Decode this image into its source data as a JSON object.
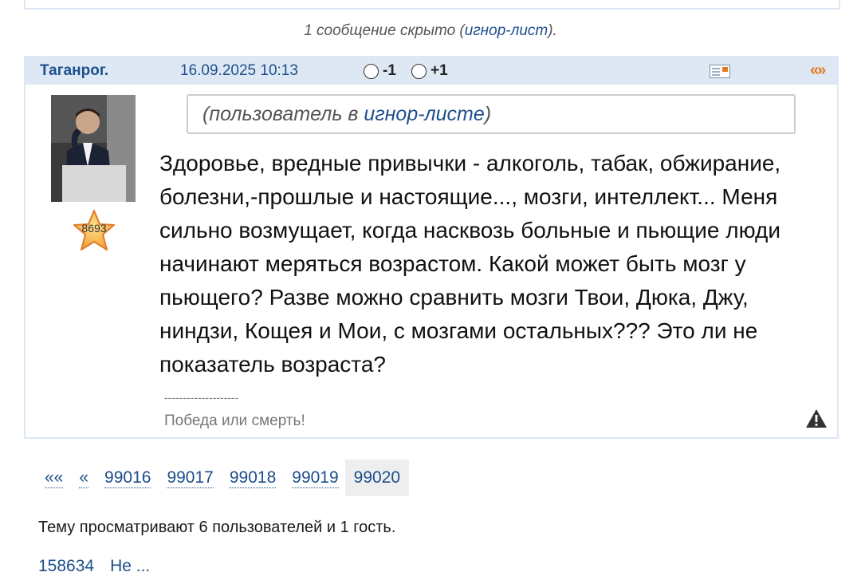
{
  "hidden_note": {
    "prefix": "1 сообщение скрыто (",
    "link": "игнор-лист",
    "suffix": ")."
  },
  "post": {
    "author": "Таганрог.",
    "date": "16.09.2025 10:13",
    "vote_minus": "-1",
    "vote_plus": "+1",
    "quote_label": "«»",
    "rating": "8693",
    "ignore_notice": {
      "prefix": "(пользователь в ",
      "link": "игнор-листе",
      "suffix": ")"
    },
    "body": "Здоровье, вредные привычки - алкоголь, табак, обжирание, болезни,-прошлые и настоящие..., мозги, интеллект... Меня сильно возмущает, когда насквозь больные и пьющие люди начинают меряться возрастом. Какой может быть мозг у пьющего? Разве можно сравнить мозги Твои, Дюка, Джу, ниндзи, Кощея и Мои, с мозгами остальных??? Это ли не показатель возраста?",
    "signature_line": "--------------------",
    "signature": "Победа или смерть!"
  },
  "pagination": {
    "first": "««",
    "prev": "«",
    "pages": [
      "99016",
      "99017",
      "99018",
      "99019"
    ],
    "current": "99020"
  },
  "viewers_text": "Тему просматривают 6 пользователей и 1 гость.",
  "bottom_links": [
    "158634",
    "Не ..."
  ],
  "colors": {
    "link": "#1e4f8c",
    "header_bg": "#dde8f4",
    "quote_accent": "#e67817"
  }
}
